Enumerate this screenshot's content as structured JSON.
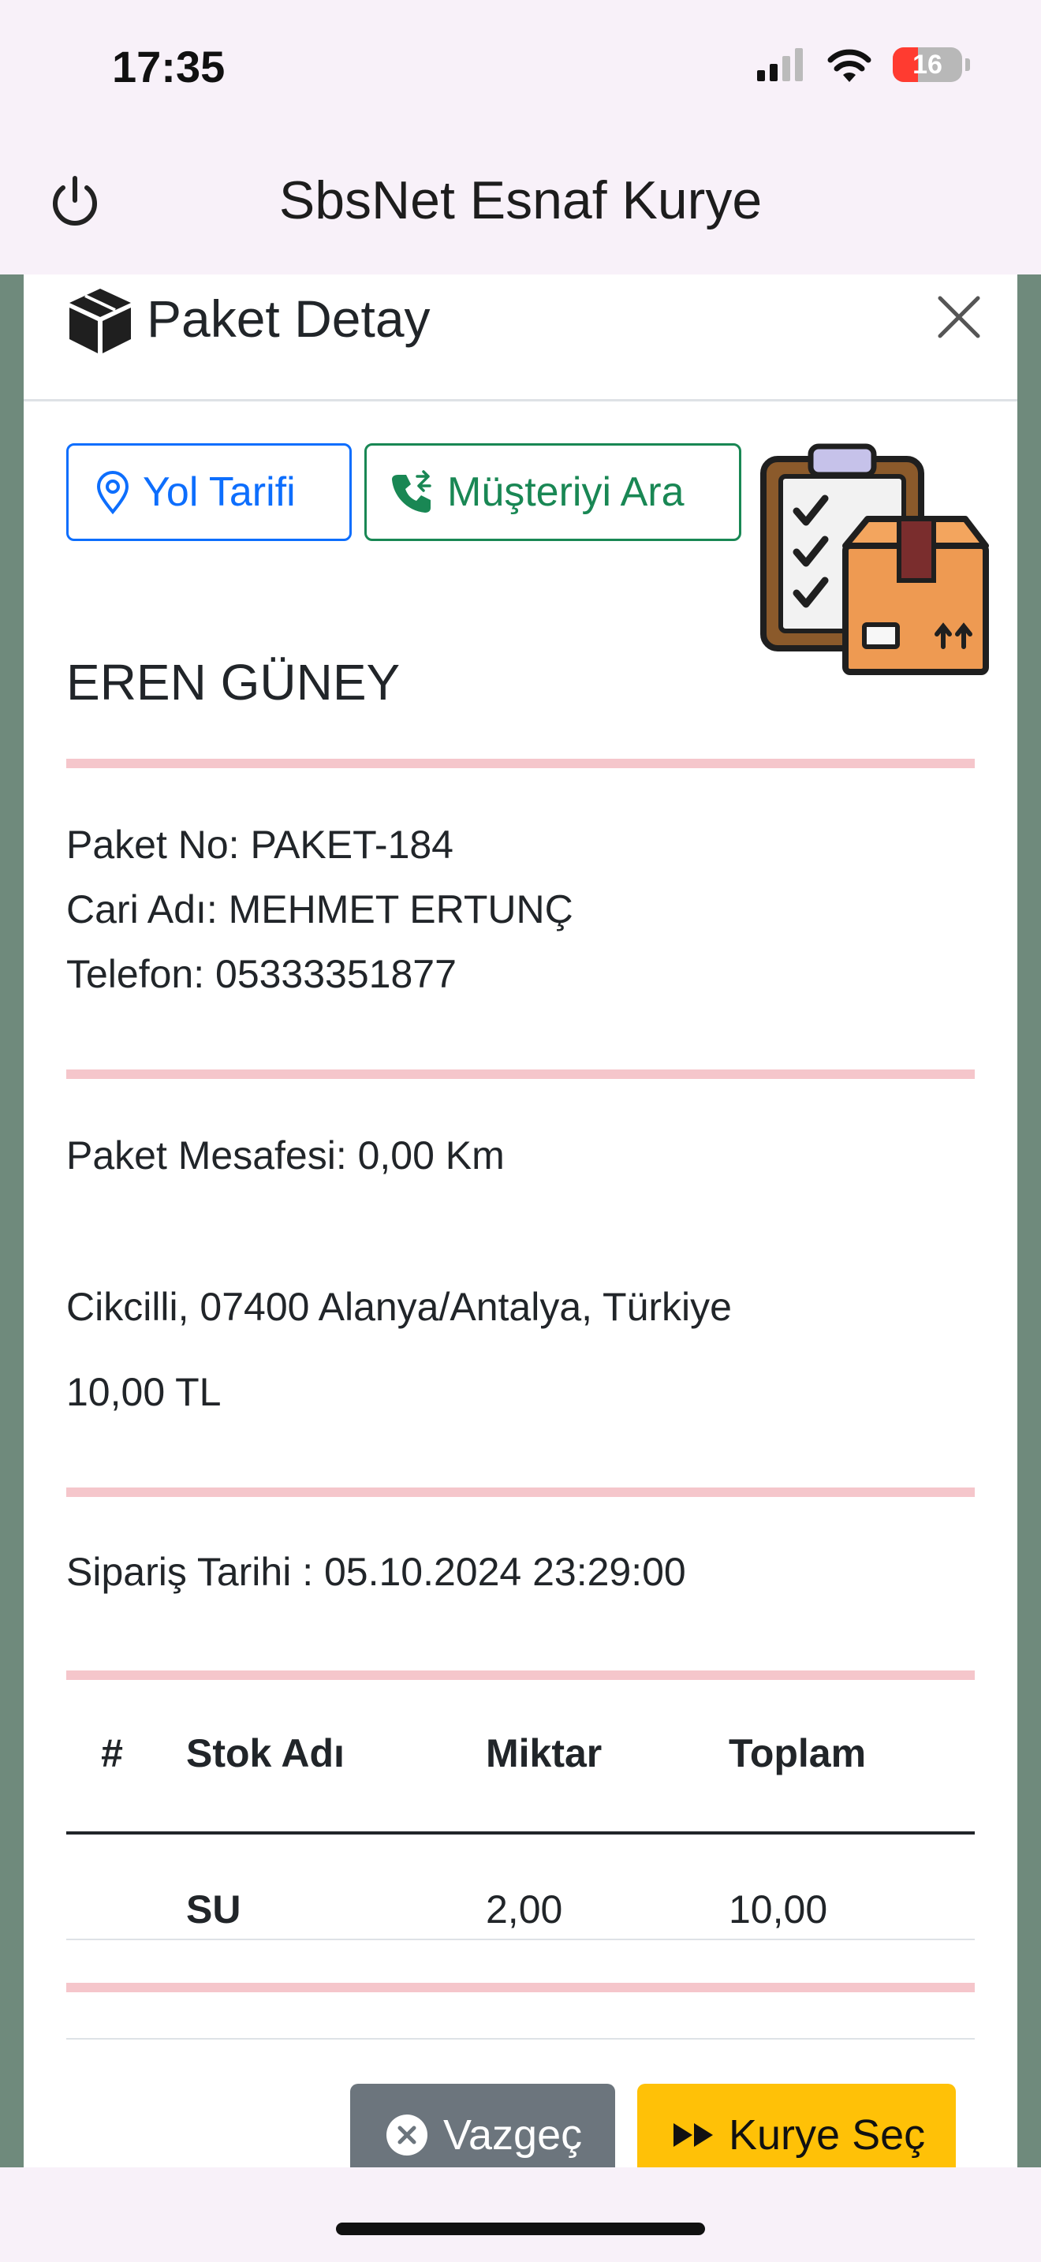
{
  "status_bar": {
    "time": "17:35",
    "battery": "16"
  },
  "app": {
    "title": "SbsNet Esnaf Kurye"
  },
  "modal": {
    "title": "Paket Detay",
    "buttons": {
      "directions": "Yol Tarifi",
      "call_customer": "Müşteriyi Ara"
    },
    "customer_name": "EREN GÜNEY",
    "package_no": "Paket No: PAKET-184",
    "account_name": "Cari Adı: MEHMET ERTUNÇ",
    "phone": "Telefon: 05333351877",
    "distance": "Paket Mesafesi: 0,00 Km",
    "address": "Cikcilli, 07400 Alanya/Antalya, Türkiye",
    "amount": "10,00 TL",
    "order_date": "Sipariş Tarihi : 05.10.2024 23:29:00",
    "table": {
      "headers": [
        "#",
        "Stok Adı",
        "Miktar",
        "Toplam"
      ],
      "rows": [
        {
          "index": "",
          "name": "SU",
          "quantity": "2,00",
          "total": "10,00"
        }
      ]
    },
    "footer": {
      "cancel": "Vazgeç",
      "select_courier": "Kurye Seç"
    }
  },
  "colors": {
    "primary": "#0d6efd",
    "success": "#198754",
    "warning": "#ffc107",
    "secondary": "#6c757d",
    "separator": "#f5c6cb"
  }
}
